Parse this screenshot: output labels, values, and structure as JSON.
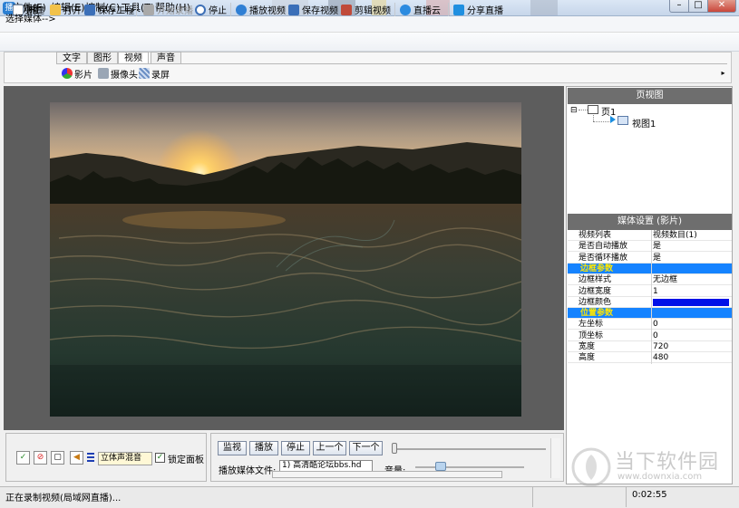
{
  "window": {
    "title": "网播",
    "app_icon": "broadcast-app-icon",
    "controls": {
      "minimize": "–",
      "maximize": "□",
      "close": "✕"
    }
  },
  "menu": [
    {
      "label": "文件(F)"
    },
    {
      "label": "编辑(E)"
    },
    {
      "label": "控制(C)"
    },
    {
      "label": "工具(T)"
    },
    {
      "label": "帮助(H)"
    }
  ],
  "toolbar": {
    "new": "新建",
    "open": "打开",
    "save_project": "保存工程",
    "start_record": "开始录播",
    "stop": "停止",
    "play_video": "播放视频",
    "save_video": "保存视频",
    "edit_video": "剪辑视频",
    "live_cloud": "直播云",
    "share_live": "分享直播"
  },
  "media_panel": {
    "select_label": "选择媒体-->",
    "tabs": [
      "文字",
      "图形",
      "视频",
      "声音"
    ],
    "active_tab": "视频",
    "sub_buttons": {
      "movie": "影片",
      "camera": "摄像头",
      "screen_record": "录屏"
    },
    "scroll_arrow": "▸"
  },
  "page_view": {
    "header": "页视图",
    "page_node": "页1",
    "view_node": "视图1",
    "expander": "⊟"
  },
  "media_settings": {
    "header": "媒体设置 (影片)",
    "rows": [
      {
        "key": "视频列表",
        "value": "视频数目(1)",
        "section": false
      },
      {
        "key": "是否自动播放",
        "value": "是",
        "section": false
      },
      {
        "key": "是否循环播放",
        "value": "是",
        "section": false
      },
      {
        "key": "边框参数",
        "value": "",
        "section": true
      },
      {
        "key": "边框样式",
        "value": "无边框",
        "section": false
      },
      {
        "key": "边框宽度",
        "value": "1",
        "section": false
      },
      {
        "key": "边框颜色",
        "value": "",
        "section": false,
        "swatch": "#0010e8"
      },
      {
        "key": "位置参数",
        "value": "",
        "section": true
      },
      {
        "key": "左坐标",
        "value": "0",
        "section": false
      },
      {
        "key": "顶坐标",
        "value": "0",
        "section": false
      },
      {
        "key": "宽度",
        "value": "720",
        "section": false
      },
      {
        "key": "高度",
        "value": "480",
        "section": false
      }
    ]
  },
  "audio_panel": {
    "mixer_value": "立体声混音",
    "lock_label": "锁定面板",
    "lock_checked": true,
    "icons": [
      "green-tool-icon",
      "red-stop-icon",
      "blank-page-icon",
      "speaker-icon",
      "equalizer-icon"
    ]
  },
  "playback": {
    "buttons": {
      "monitor": "监视",
      "play": "播放",
      "stop": "停止",
      "prev": "上一个",
      "next": "下一个"
    },
    "file_label": "播放媒体文件:",
    "file_value": "1) 高清酷论坛bbs.hd",
    "volume_label": "音量:",
    "volume_level": 0.2,
    "progress": 0.0
  },
  "status": {
    "text": "正在录制视频(局域网直播)...",
    "time": "0:02:55"
  },
  "watermark": {
    "brand": "当下软件园",
    "url": "www.downxia.com"
  },
  "colors": {
    "section_bg": "#1583ff",
    "section_text": "#ffe600",
    "panel_header": "#6e6e6e",
    "preview_bg": "#5d5d5d"
  }
}
